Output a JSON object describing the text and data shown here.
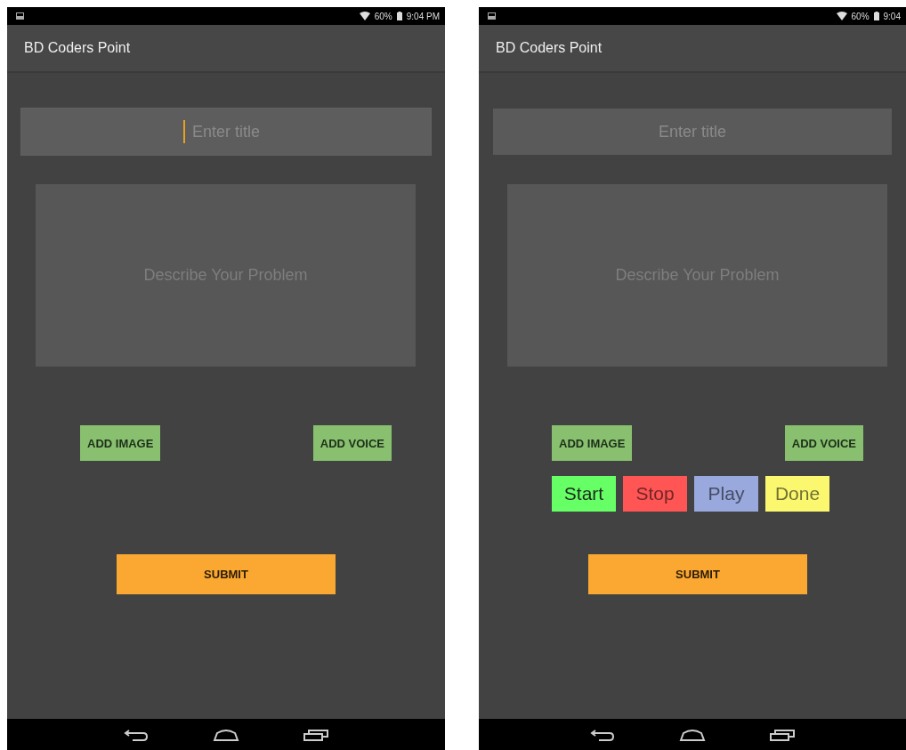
{
  "phones": [
    {
      "status": {
        "battery": "60%",
        "time": "9:04 PM"
      },
      "app_title": "BD Coders Point",
      "title_field": {
        "placeholder": "Enter title",
        "focused": true
      },
      "description_field": {
        "placeholder": "Describe Your Problem"
      },
      "media_buttons": [
        "ADD IMAGE",
        "ADD VOICE"
      ],
      "submit": "SUBMIT"
    },
    {
      "status": {
        "battery": "60%",
        "time": "9:04"
      },
      "app_title": "BD Coders Point",
      "title_field": {
        "placeholder": "Enter title",
        "focused": false
      },
      "description_field": {
        "placeholder": "Describe Your Problem"
      },
      "media_buttons": [
        "ADD IMAGE",
        "ADD VOICE"
      ],
      "recorder_buttons": [
        {
          "label": "Start",
          "color": "#66ff66",
          "disabled": false
        },
        {
          "label": "Stop",
          "color": "#ff5555",
          "disabled": true
        },
        {
          "label": "Play",
          "color": "#99a8dd",
          "disabled": true
        },
        {
          "label": "Done",
          "color": "#fbf870",
          "disabled": true
        }
      ],
      "submit": "SUBMIT"
    }
  ]
}
